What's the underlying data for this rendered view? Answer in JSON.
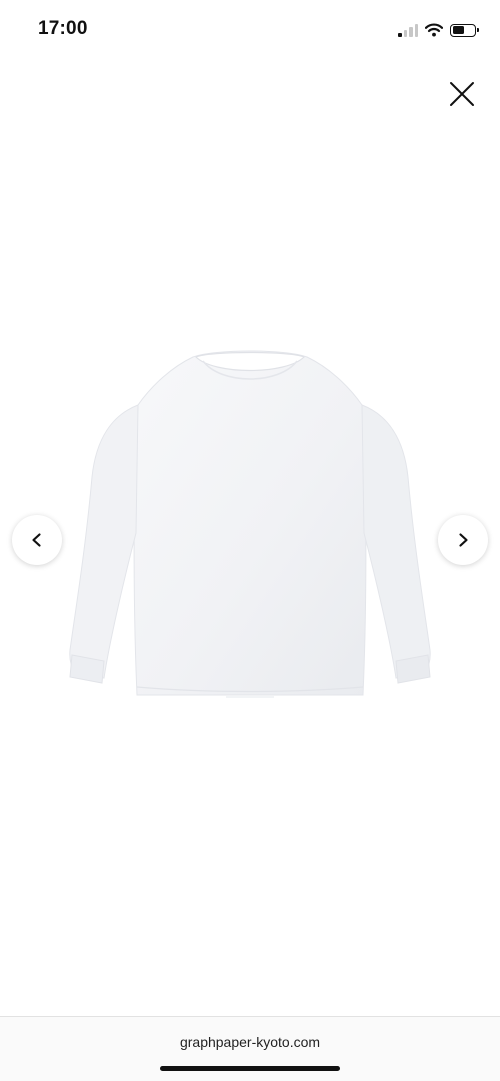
{
  "status_bar": {
    "time": "17:00",
    "signal_bars_active": 1,
    "battery_level": 0.55,
    "icons": [
      "cellular-signal-icon",
      "wifi-icon",
      "battery-icon"
    ]
  },
  "viewer": {
    "close_icon": "close-icon",
    "prev_icon": "chevron-left-icon",
    "next_icon": "chevron-right-icon",
    "image_subject": "white long-sleeve t-shirt"
  },
  "browser": {
    "url": "graphpaper-kyoto.com"
  },
  "colors": {
    "background": "#ffffff",
    "text": "#111111",
    "shirt": "#f3f4f6"
  }
}
